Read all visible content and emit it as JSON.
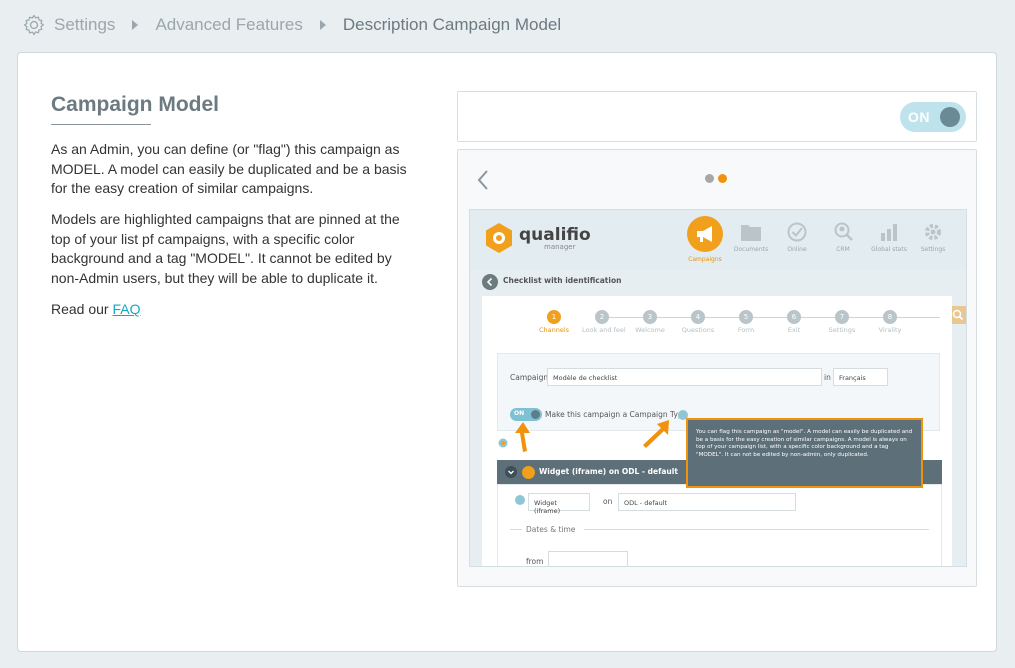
{
  "breadcrumb": {
    "icon": "gear-icon",
    "items": [
      "Settings",
      "Advanced Features",
      "Description Campaign Model"
    ]
  },
  "content": {
    "title": "Campaign Model",
    "paragraph1": "As an Admin, you can define (or \"flag\") this campaign as MODEL. A model can easily be duplicated and be a basis for the easy creation of similar campaigns.",
    "paragraph2": "Models are highlighted campaigns that are pinned at the top of your list pf campaigns, with a specific color background and a tag \"MODEL\". It cannot be edited by non-Admin users, but they will be able to duplicate it.",
    "read_prefix": "Read our ",
    "faq_label": "FAQ"
  },
  "toggle": {
    "label": "ON",
    "state": true
  },
  "slider": {
    "dots": 2,
    "active_dot": 2,
    "prev_icon": "chevron-left-icon"
  },
  "screenshot": {
    "logo": "qualifio",
    "logo_sub": "manager",
    "nav": [
      "Campaigns",
      "Documents",
      "Online",
      "CRM",
      "Global stats",
      "Settings"
    ],
    "subtitle": "Checklist with identification",
    "steps": [
      "Channels",
      "Look and feel",
      "Welcome",
      "Questions",
      "Form",
      "Exit",
      "Settings",
      "Virality"
    ],
    "campaign_label": "Campaign",
    "campaign_value": "Modèle de checklist",
    "in_label": "in",
    "language": "Français",
    "toggle_label": "ON",
    "toggle_text": "Make this campaign a Campaign Type",
    "tooltip": "You can flag this campaign as \"model\". A model can easily be duplicated and be a basis for the easy creation of similar campaigns. A model is always on top of your campaign list, with a specific color background and a tag \"MODEL\". It can not be edited by non-admin, only duplicated.",
    "widget_title": "Widget (iframe) on ODL - default",
    "widget_select": "Widget (iframe)",
    "on_label": "on",
    "odl_select": "ODL - default",
    "dates_label": "Dates & time",
    "from_label": "from"
  },
  "colors": {
    "accent": "#17a8c6",
    "orange": "#f0920c",
    "toggle_bg": "#bfe3ed",
    "toggle_knob": "#6a8b95",
    "title": "#6c7a82"
  }
}
